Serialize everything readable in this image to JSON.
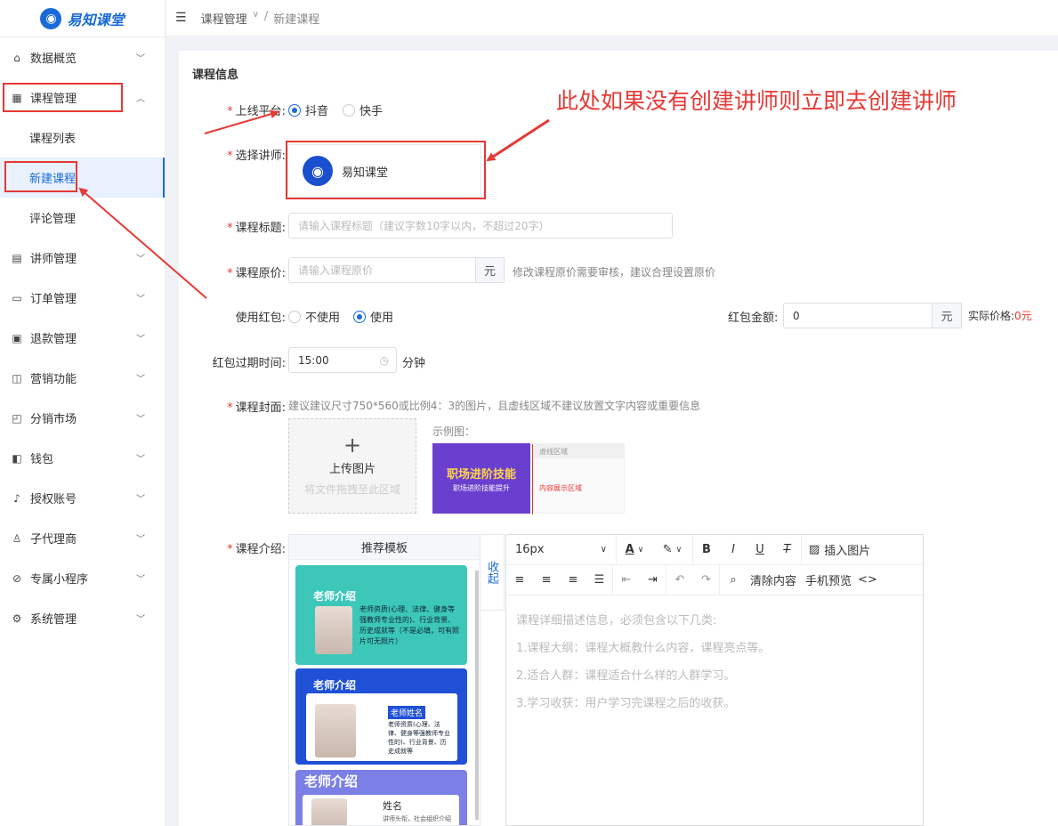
{
  "logo": {
    "text": "易知课堂"
  },
  "breadcrumb": {
    "parent": "课程管理",
    "sep": "/",
    "current": "新建课程"
  },
  "sidebar": {
    "items": [
      {
        "label": "数据概览",
        "icon": "home-icon"
      },
      {
        "label": "课程管理",
        "icon": "grid-icon"
      },
      {
        "label": "课程列表"
      },
      {
        "label": "新建课程"
      },
      {
        "label": "评论管理"
      },
      {
        "label": "讲师管理",
        "icon": "teacher-icon"
      },
      {
        "label": "订单管理",
        "icon": "order-icon"
      },
      {
        "label": "退款管理",
        "icon": "refund-icon"
      },
      {
        "label": "营销功能",
        "icon": "bag-icon"
      },
      {
        "label": "分销市场",
        "icon": "shop-icon"
      },
      {
        "label": "钱包",
        "icon": "wallet-icon"
      },
      {
        "label": "授权账号",
        "icon": "tiktok-icon"
      },
      {
        "label": "子代理商",
        "icon": "agent-icon"
      },
      {
        "label": "专属小程序",
        "icon": "mini-app-icon"
      },
      {
        "label": "系统管理",
        "icon": "gear-icon"
      }
    ]
  },
  "form": {
    "section_title": "课程信息",
    "platform": {
      "label": "上线平台:",
      "options": [
        "抖音",
        "快手"
      ],
      "selected": "抖音"
    },
    "teacher": {
      "label": "选择讲师:",
      "name": "易知课堂"
    },
    "title": {
      "label": "课程标题:",
      "placeholder": "请输入课程标题（建议字数10字以内，不超过20字）"
    },
    "price": {
      "label": "课程原价:",
      "placeholder": "请输入课程原价",
      "unit": "元",
      "hint": "修改课程原价需要审核，建议合理设置原价"
    },
    "redpacket": {
      "label": "使用红包:",
      "options": [
        "不使用",
        "使用"
      ],
      "selected": "使用",
      "amount_label": "红包金额:",
      "amount": "0",
      "unit": "元",
      "actual_label": "实际价格:",
      "actual_value": "0元"
    },
    "expire": {
      "label": "红包过期时间:",
      "value": "15:00",
      "unit": "分钟"
    },
    "cover": {
      "label": "课程封面:",
      "hint": "建议建议尺寸750*560或比例4：3的图片，且虚线区域不建议放置文字内容或重要信息",
      "upload_plus": "+",
      "upload_label": "上传图片",
      "upload_drag": "将文件拖拽至此区域",
      "example_label": "示例图：",
      "sample_title": "职场进阶技能",
      "sample_sub": "职场进阶技能提升",
      "dashed_label": "虚线区域",
      "content_label": "内容展示区域"
    },
    "intro": {
      "label": "课程介绍:",
      "template_title": "推荐模板",
      "collapse": "收起",
      "templates": [
        {
          "title": "老师介绍",
          "text": "老师资质(心理、法律、健身等强教师专业性的)、行业背景、历史成就等（不是必填，可有照片可无照片）"
        },
        {
          "title": "老师介绍",
          "name": "老师姓名",
          "text": "老师资质(心理、法律、健身等强教师专业性的)、行业背景、历史成就等"
        },
        {
          "title": "老师介绍",
          "name": "姓名",
          "text": "讲师头衔，社会组织介绍"
        }
      ]
    }
  },
  "editor": {
    "font_size": "16px",
    "insert_image": "插入图片",
    "clear": "清除内容",
    "preview": "手机预览",
    "placeholder_lines": [
      "课程详细描述信息，必须包含以下几类:",
      "1.课程大纲：课程大概教什么内容，课程亮点等。",
      "2.适合人群：课程适合什么样的人群学习。",
      "3.学习收获：用户学习完课程之后的收获。"
    ]
  },
  "annotation": {
    "text": "此处如果没有创建讲师则立即去创建讲师"
  },
  "colors": {
    "primary": "#1a6bd8",
    "annotation": "#e53935"
  }
}
